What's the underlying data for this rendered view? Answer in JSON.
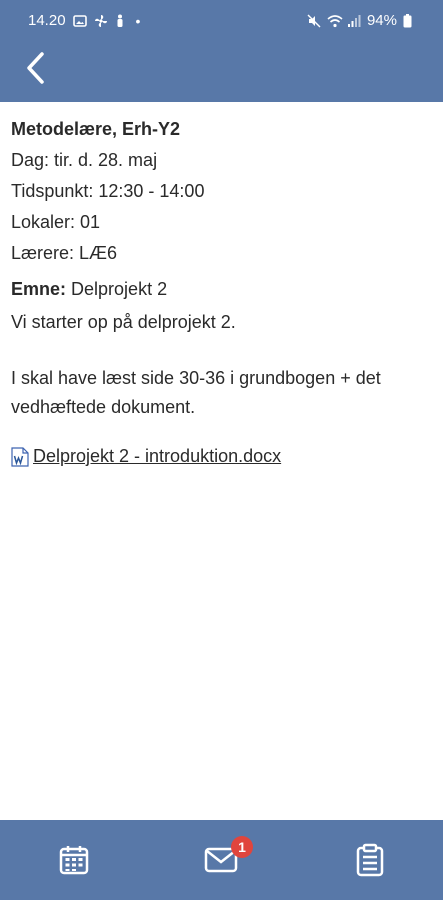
{
  "status_bar": {
    "time": "14.20",
    "battery": "94%"
  },
  "header": {
    "back_icon": "chevron-left-icon"
  },
  "lesson": {
    "title": "Metodelære, Erh-Y2",
    "day": "Dag: tir. d. 28. maj",
    "time": "Tidspunkt: 12:30 - 14:00",
    "room": "Lokaler: 01",
    "teacher": "Lærere: LÆ6",
    "topic_label": "Emne:",
    "topic_value": "Delprojekt 2",
    "description_1": "Vi starter op på delprojekt 2.",
    "description_2": "I skal have læst side 30-36 i grundbogen + det vedhæftede dokument.",
    "attachment": "Delprojekt 2 - introduktion.docx"
  },
  "bottom_nav": {
    "items": [
      {
        "icon": "calendar-icon"
      },
      {
        "icon": "mail-icon",
        "badge": "1"
      },
      {
        "icon": "clipboard-icon"
      }
    ]
  },
  "colors": {
    "bar": "#5878a8",
    "badge": "#e0453d"
  }
}
